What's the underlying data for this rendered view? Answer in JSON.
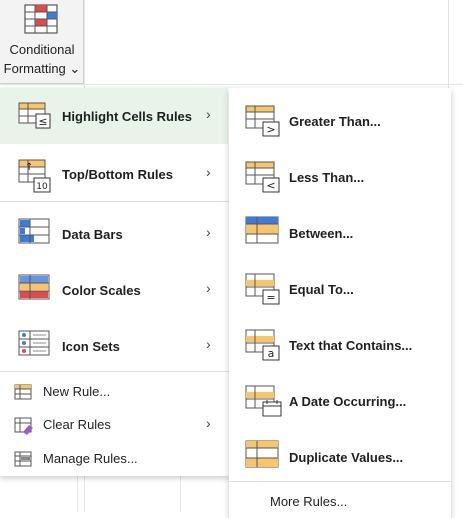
{
  "ribbon": {
    "button_line1": "Conditional",
    "button_line2": "Formatting",
    "dropdown_glyph": "⌄",
    "icon": "conditional-formatting-icon"
  },
  "menu": {
    "items": [
      {
        "label": "Highlight Cells Rules",
        "icon": "highlight-cells-icon",
        "has_submenu": true,
        "active": true
      },
      {
        "label": "Top/Bottom Rules",
        "icon": "top-bottom-icon",
        "has_submenu": true
      },
      {
        "label": "Data Bars",
        "icon": "data-bars-icon",
        "has_submenu": true
      },
      {
        "label": "Color Scales",
        "icon": "color-scales-icon",
        "has_submenu": true
      },
      {
        "label": "Icon Sets",
        "icon": "icon-sets-icon",
        "has_submenu": true
      }
    ],
    "small_items": [
      {
        "label": "New Rule...",
        "icon": "new-rule-icon"
      },
      {
        "label": "Clear Rules",
        "icon": "clear-rules-icon",
        "has_submenu": true
      },
      {
        "label": "Manage Rules...",
        "icon": "manage-rules-icon"
      }
    ],
    "chevron": "›"
  },
  "submenu": {
    "items": [
      {
        "label": "Greater Than...",
        "icon": "greater-than-icon"
      },
      {
        "label": "Less Than...",
        "icon": "less-than-icon"
      },
      {
        "label": "Between...",
        "icon": "between-icon"
      },
      {
        "label": "Equal To...",
        "icon": "equal-to-icon"
      },
      {
        "label": "Text that Contains...",
        "icon": "text-contains-icon"
      },
      {
        "label": "A Date Occurring...",
        "icon": "date-occurring-icon"
      },
      {
        "label": "Duplicate Values...",
        "icon": "duplicate-values-icon"
      }
    ],
    "more_rules": "More Rules..."
  },
  "colors": {
    "accent_orange": "#f7c66b",
    "accent_blue": "#3b7ddd",
    "accent_red": "#e04a4a",
    "active_bg": "#e8f3ea"
  }
}
